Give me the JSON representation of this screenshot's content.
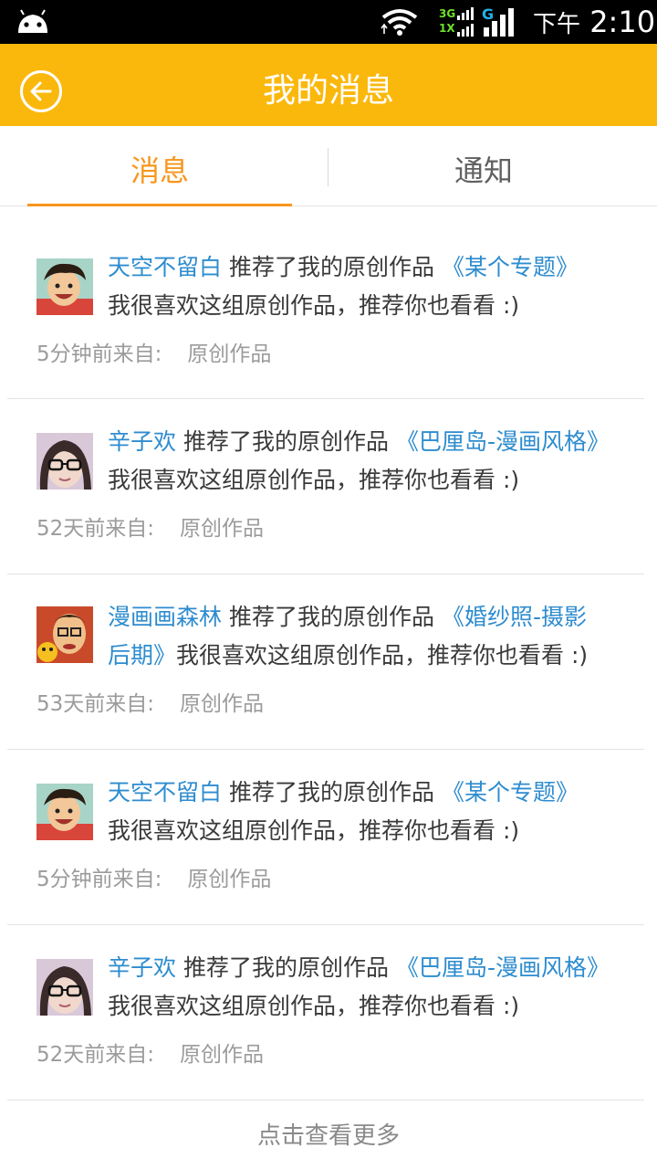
{
  "status_bar": {
    "network_3g": "3G",
    "network_1x": "1X",
    "network_g": "G",
    "ampm": "下午",
    "time": "2:10"
  },
  "header": {
    "title": "我的消息",
    "back_icon": "back-arrow-icon",
    "background": "#fbb80c"
  },
  "tabs": [
    {
      "label": "消息",
      "active": true
    },
    {
      "label": "通知",
      "active": false
    }
  ],
  "accent_color": "#f7961c",
  "link_color": "#2e8ccf",
  "messages": [
    {
      "user": "天空不留白",
      "action": "推荐了我的原创作品",
      "work": "《某个专题》",
      "comment": "我很喜欢这组原创作品，推荐你也看看 :)",
      "time": "5分钟前来自:",
      "source": "原创作品",
      "avatar": "cartoon-boy-avatar"
    },
    {
      "user": "辛子欢",
      "action": "推荐了我的原创作品",
      "work": "《巴厘岛-漫画风格》",
      "comment": "我很喜欢这组原创作品，推荐你也看看 :)",
      "time": "52天前来自:",
      "source": "原创作品",
      "avatar": "girl-glasses-avatar"
    },
    {
      "user": "漫画画森林",
      "action": "推荐了我的原创作品",
      "work_part1": "《婚纱照-摄影",
      "work_part2": "后期》",
      "comment": "我很喜欢这组原创作品，推荐你也看看 :)",
      "time": "53天前来自:",
      "source": "原创作品",
      "avatar": "cartoon-man-avatar"
    },
    {
      "user": "天空不留白",
      "action": "推荐了我的原创作品",
      "work": "《某个专题》",
      "comment": "我很喜欢这组原创作品，推荐你也看看 :)",
      "time": "5分钟前来自:",
      "source": "原创作品",
      "avatar": "cartoon-boy-avatar"
    },
    {
      "user": "辛子欢",
      "action": "推荐了我的原创作品",
      "work": "《巴厘岛-漫画风格》",
      "comment": "我很喜欢这组原创作品，推荐你也看看 :)",
      "time": "52天前来自:",
      "source": "原创作品",
      "avatar": "girl-glasses-avatar"
    }
  ],
  "load_more": "点击查看更多"
}
